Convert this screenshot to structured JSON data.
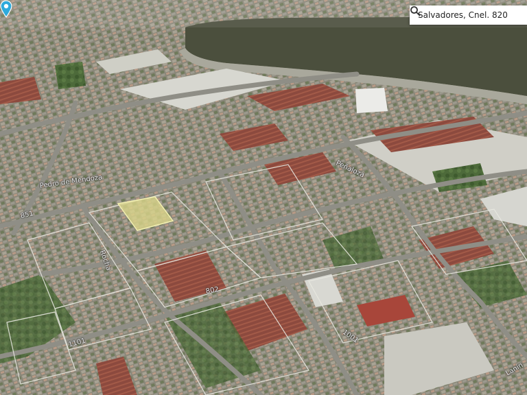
{
  "search": {
    "value": "Salvadores, Cnel. 820",
    "icon": "search-icon"
  },
  "streets": {
    "label_1": "Peñaloza",
    "label_2": "Ponce",
    "label_3": "Lanín",
    "label_4": "Peñaloza",
    "label_5": "Ponce",
    "label_6": "Lanín",
    "label_7": "Pedro de Mendoza",
    "label_8": "Rocha"
  },
  "numbers": {
    "n1": "802",
    "n2": "1001",
    "n3": "851",
    "n4": "1101"
  },
  "marker": {
    "icon": "location-pin-icon",
    "color": "#2eaadc"
  },
  "colors": {
    "water": "#4a4f3e",
    "highlight": "#d9d58a"
  }
}
